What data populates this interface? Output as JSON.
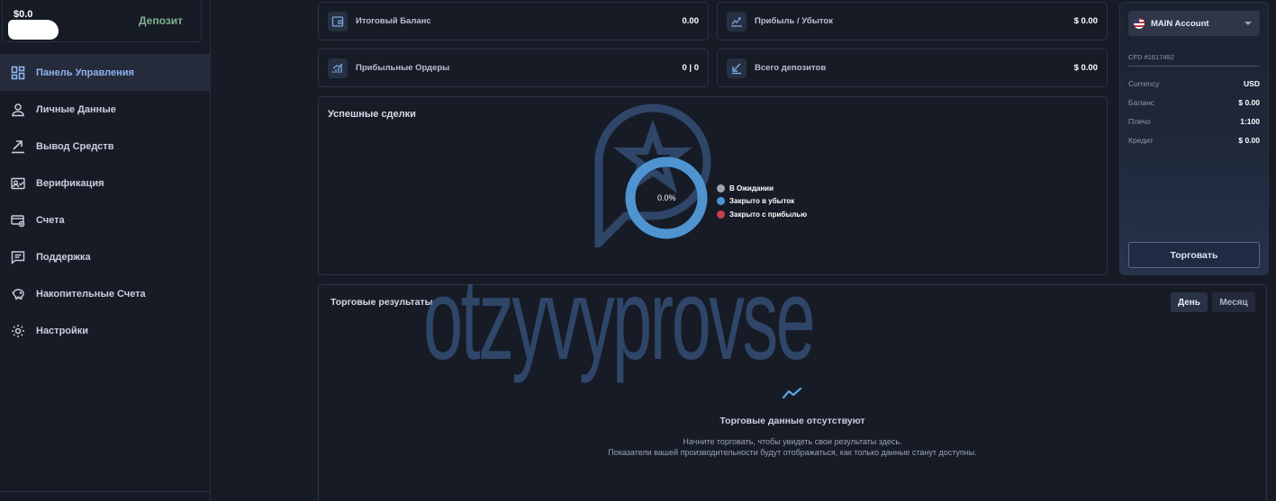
{
  "sidebar": {
    "balance": "$0.0",
    "deposit_label": "Депозит",
    "items": [
      {
        "label": "Панель Управления",
        "icon": "dashboard-icon",
        "active": true
      },
      {
        "label": "Личные Данные",
        "icon": "user-icon"
      },
      {
        "label": "Вывод Средств",
        "icon": "withdraw-icon"
      },
      {
        "label": "Верификация",
        "icon": "id-card-icon"
      },
      {
        "label": "Счета",
        "icon": "card-icon"
      },
      {
        "label": "Поддержка",
        "icon": "chat-icon"
      },
      {
        "label": "Накопительные Счета",
        "icon": "piggy-bank-icon"
      },
      {
        "label": "Настройки",
        "icon": "gear-icon"
      }
    ]
  },
  "stats": {
    "total_balance": {
      "label": "Итоговый Баланс",
      "value": "0.00",
      "icon": "wallet-icon"
    },
    "profit_loss": {
      "label": "Прибыль / Убыток",
      "value": "$ 0.00",
      "icon": "chart-line-icon"
    },
    "profitable_orders": {
      "label": "Прибыльные Ордеры",
      "value": "0 | 0",
      "icon": "bar-chart-icon"
    },
    "total_deposits": {
      "label": "Всего депозитов",
      "value": "$ 0.00",
      "icon": "arrow-down-left-icon"
    }
  },
  "successful_trades": {
    "title": "Успешные сделки",
    "center_label": "0.0%",
    "legend": [
      {
        "label": "В Ожидании",
        "color": "#9ea6b4"
      },
      {
        "label": "Закрыто в убыток",
        "color": "#4f94d1"
      },
      {
        "label": "Закрыто с прибылью",
        "color": "#c8404e"
      }
    ],
    "ring_color": "#4f94d1"
  },
  "trading_results": {
    "title": "Торговые результаты",
    "period_day": "День",
    "period_month": "Месяц",
    "empty_title": "Торговые данные отсутствуют",
    "empty_line1": "Начните торговать, чтобы увидеть свои результаты здесь.",
    "empty_line2": "Показатели вашей производительности будут отображаться, как только данные станут доступны."
  },
  "account": {
    "name": "MAIN Account",
    "id": "CFD #1617492",
    "rows": [
      {
        "key": "Currency",
        "value": "USD"
      },
      {
        "key": "Баланс",
        "value": "$ 0.00"
      },
      {
        "key": "Плечо",
        "value": "1:100"
      },
      {
        "key": "Кредит",
        "value": "$ 0.00"
      }
    ],
    "trade_button": "Торговать"
  },
  "watermark": {
    "text": "otzyvyprovse"
  }
}
